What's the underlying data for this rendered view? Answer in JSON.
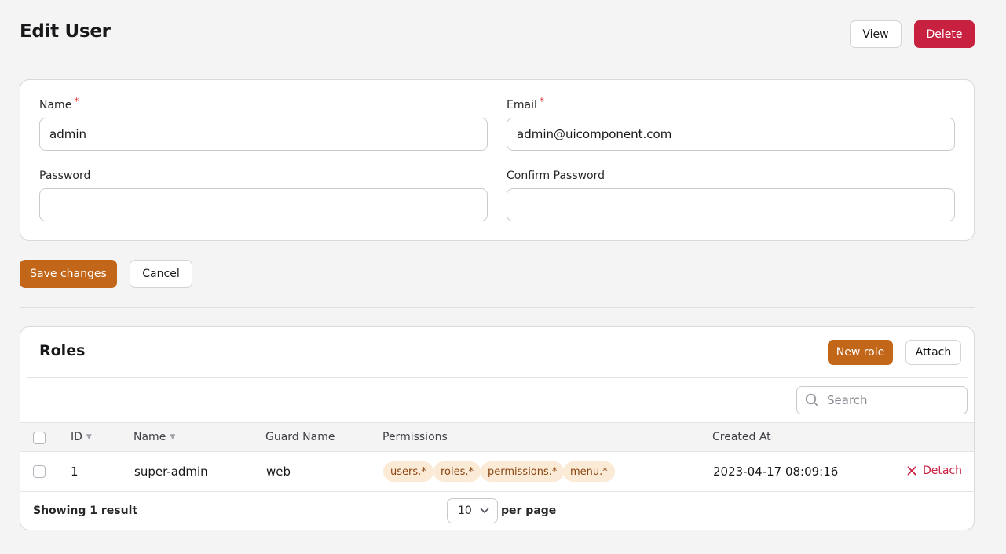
{
  "header": {
    "title": "Edit User",
    "view_label": "View",
    "delete_label": "Delete"
  },
  "form": {
    "name_label": "Name",
    "name_value": "admin",
    "email_label": "Email",
    "email_value": "admin@uicomponent.com",
    "required_mark": "*",
    "password_label": "Password",
    "password_value": "",
    "confirm_password_label": "Confirm Password",
    "confirm_password_value": ""
  },
  "actions": {
    "save_label": "Save changes",
    "cancel_label": "Cancel"
  },
  "roles": {
    "title": "Roles",
    "new_role_label": "New role",
    "attach_label": "Attach",
    "search_placeholder": "Search",
    "columns": {
      "id": "ID",
      "name": "Name",
      "guard_name": "Guard Name",
      "permissions": "Permissions",
      "created_at": "Created At"
    },
    "rows": [
      {
        "id": "1",
        "name": "super-admin",
        "guard_name": "web",
        "permissions": [
          "users.*",
          "roles.*",
          "permissions.*",
          "menu.*"
        ],
        "created_at": "2023-04-17 08:09:16",
        "detach_label": "Detach"
      }
    ],
    "footer": {
      "showing": "Showing 1 result",
      "per_page_value": "10",
      "per_page_label": "per page"
    }
  },
  "colors": {
    "primary": "#c2661a",
    "danger": "#c8203f",
    "badge_bg": "#fbead6",
    "badge_text": "#8a4510"
  },
  "icons": {
    "search": "search-icon",
    "detach": "x-icon",
    "select": "chevron-down-icon",
    "sort": "sort-icon"
  }
}
